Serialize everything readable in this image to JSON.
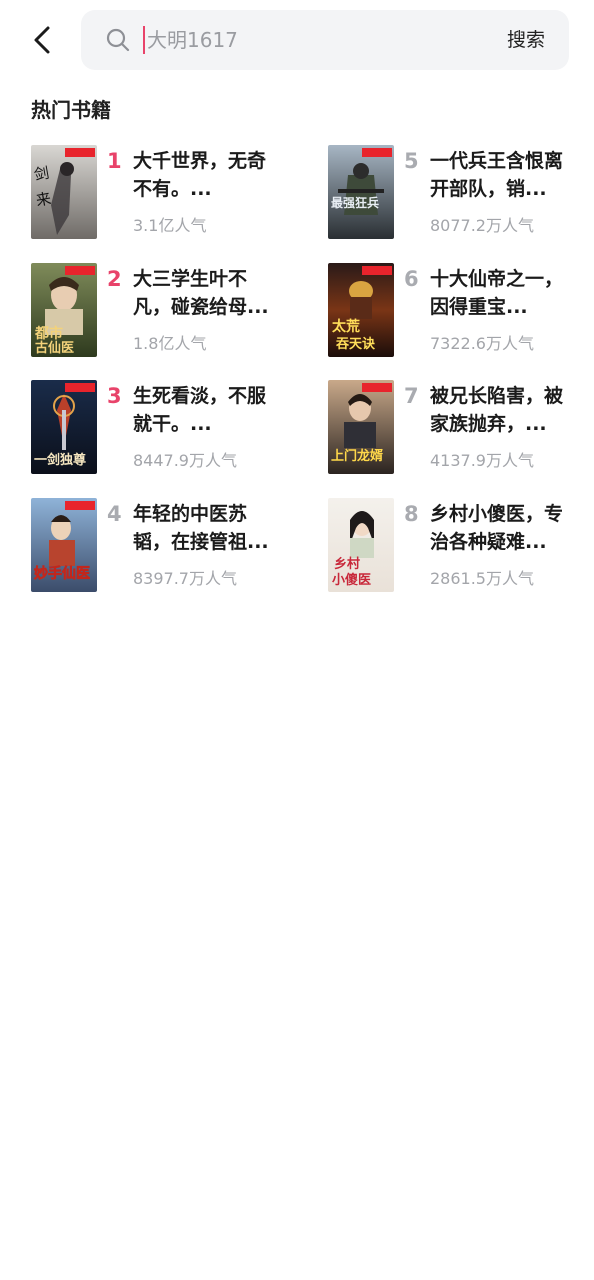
{
  "search": {
    "placeholder": "大明1617",
    "submit_label": "搜索"
  },
  "section_title": "热门书籍",
  "books": [
    {
      "rank": "1",
      "title": "大千世界，无奇不有。...",
      "popularity": "3.1亿人气",
      "cover_text": "剑来"
    },
    {
      "rank": "2",
      "title": "大三学生叶不凡，碰瓷给母...",
      "popularity": "1.8亿人气",
      "cover_text": "都市古仙医"
    },
    {
      "rank": "3",
      "title": "生死看淡，不服就干。...",
      "popularity": "8447.9万人气",
      "cover_text": "一剑独尊"
    },
    {
      "rank": "4",
      "title": "年轻的中医苏韬，在接管祖...",
      "popularity": "8397.7万人气",
      "cover_text": "妙手仙医"
    },
    {
      "rank": "5",
      "title": "一代兵王含恨离开部队，销...",
      "popularity": "8077.2万人气",
      "cover_text": "最强狂兵"
    },
    {
      "rank": "6",
      "title": "十大仙帝之一，因得重宝...",
      "popularity": "7322.6万人气",
      "cover_text": "太荒吞天诀"
    },
    {
      "rank": "7",
      "title": "被兄长陷害，被家族抛弃，...",
      "popularity": "4137.9万人气",
      "cover_text": "上门龙婿"
    },
    {
      "rank": "8",
      "title": "乡村小傻医，专治各种疑难...",
      "popularity": "2861.5万人气",
      "cover_text": "乡村小傻医"
    }
  ],
  "colors": {
    "accent": "#e8436a",
    "rank_muted": "#a9abb0",
    "search_bg": "#f3f4f6"
  }
}
